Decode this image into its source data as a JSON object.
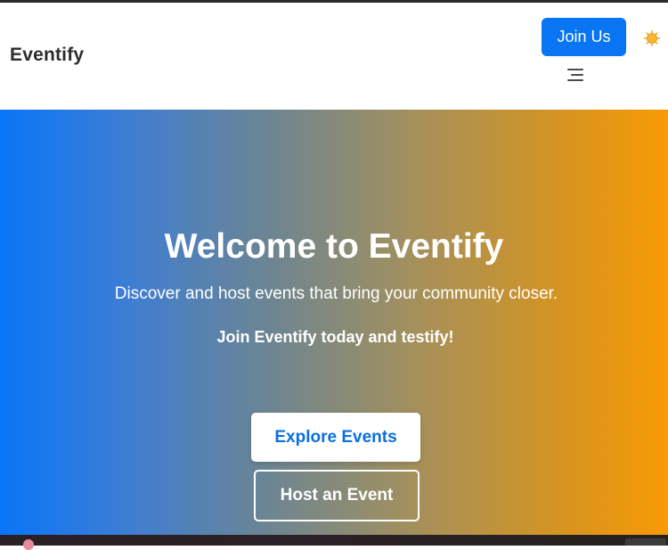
{
  "header": {
    "brand": "Eventify",
    "join_label": "Join Us",
    "theme_icon": "sun-icon",
    "menu_icon": "hamburger-menu-icon"
  },
  "hero": {
    "title": "Welcome to Eventify",
    "subtitle": "Discover and host events that bring your community closer.",
    "tagline": "Join Eventify today and testify!",
    "explore_label": "Explore Events",
    "host_label": "Host an Event"
  },
  "colors": {
    "primary": "#0a75f2",
    "gradient_start": "#0a75f8",
    "gradient_end": "#f89a07",
    "sun": "#f5a623"
  }
}
